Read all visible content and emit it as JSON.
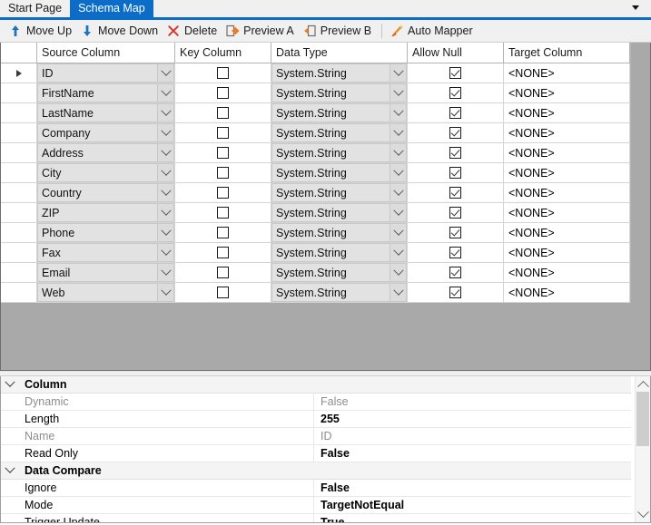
{
  "tabs": [
    {
      "label": "Start Page",
      "active": false
    },
    {
      "label": "Schema Map",
      "active": true
    }
  ],
  "tabbar": {
    "overflow_icon": "chevron-down-icon"
  },
  "toolbar": {
    "items": [
      {
        "label": "Move Up",
        "icon": "arrow-up-icon"
      },
      {
        "label": "Move Down",
        "icon": "arrow-down-icon"
      },
      {
        "label": "Delete",
        "icon": "x-delete-icon"
      },
      {
        "label": "Preview A",
        "icon": "preview-a-icon"
      },
      {
        "label": "Preview B",
        "icon": "preview-b-icon"
      },
      {
        "label": "Auto Mapper",
        "icon": "auto-mapper-wand-icon"
      }
    ],
    "separator_before": "Auto Mapper"
  },
  "grid": {
    "columns": [
      "Source Column",
      "Key Column",
      "Data Type",
      "Allow Null",
      "Target Column"
    ],
    "rows": [
      {
        "selected": true,
        "source": "ID",
        "key": false,
        "type": "System.String",
        "allow_null": true,
        "target": "<NONE>"
      },
      {
        "selected": false,
        "source": "FirstName",
        "key": false,
        "type": "System.String",
        "allow_null": true,
        "target": "<NONE>"
      },
      {
        "selected": false,
        "source": "LastName",
        "key": false,
        "type": "System.String",
        "allow_null": true,
        "target": "<NONE>"
      },
      {
        "selected": false,
        "source": "Company",
        "key": false,
        "type": "System.String",
        "allow_null": true,
        "target": "<NONE>"
      },
      {
        "selected": false,
        "source": "Address",
        "key": false,
        "type": "System.String",
        "allow_null": true,
        "target": "<NONE>"
      },
      {
        "selected": false,
        "source": "City",
        "key": false,
        "type": "System.String",
        "allow_null": true,
        "target": "<NONE>"
      },
      {
        "selected": false,
        "source": "Country",
        "key": false,
        "type": "System.String",
        "allow_null": true,
        "target": "<NONE>"
      },
      {
        "selected": false,
        "source": "ZIP",
        "key": false,
        "type": "System.String",
        "allow_null": true,
        "target": "<NONE>"
      },
      {
        "selected": false,
        "source": "Phone",
        "key": false,
        "type": "System.String",
        "allow_null": true,
        "target": "<NONE>"
      },
      {
        "selected": false,
        "source": "Fax",
        "key": false,
        "type": "System.String",
        "allow_null": true,
        "target": "<NONE>"
      },
      {
        "selected": false,
        "source": "Email",
        "key": false,
        "type": "System.String",
        "allow_null": true,
        "target": "<NONE>"
      },
      {
        "selected": false,
        "source": "Web",
        "key": false,
        "type": "System.String",
        "allow_null": true,
        "target": "<NONE>"
      }
    ]
  },
  "properties": {
    "groups": [
      {
        "name": "Column",
        "rows": [
          {
            "name": "Dynamic",
            "value": "False",
            "readonly": true
          },
          {
            "name": "Length",
            "value": "255",
            "readonly": false
          },
          {
            "name": "Name",
            "value": "ID",
            "readonly": true
          },
          {
            "name": "Read Only",
            "value": "False",
            "readonly": false
          }
        ]
      },
      {
        "name": "Data Compare",
        "rows": [
          {
            "name": "Ignore",
            "value": "False",
            "readonly": false
          },
          {
            "name": "Mode",
            "value": "TargetNotEqual",
            "readonly": false
          },
          {
            "name": "Trigger Update",
            "value": "True",
            "readonly": false
          }
        ]
      }
    ]
  },
  "colors": {
    "accent": "#0b6dc7",
    "icon_orange": "#f07b1e",
    "icon_blue": "#1e73be",
    "icon_red": "#d9342b",
    "pane_background": "#a9a9a9"
  }
}
